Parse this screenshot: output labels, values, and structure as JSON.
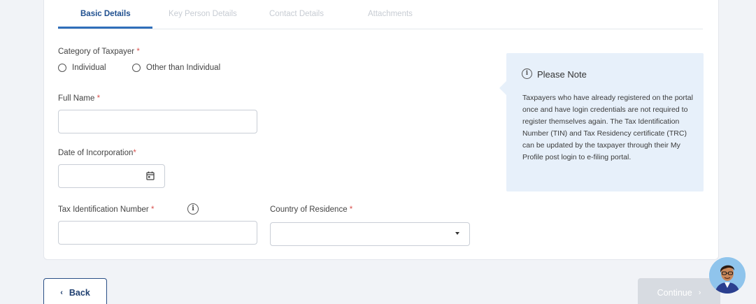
{
  "tabs": [
    {
      "label": "Basic Details",
      "active": true
    },
    {
      "label": "Key Person Details",
      "active": false
    },
    {
      "label": "Contact Details",
      "active": false
    },
    {
      "label": "Attachments",
      "active": false
    }
  ],
  "form": {
    "category_label": "Category of Taxpayer",
    "required_mark": "*",
    "category_options": [
      "Individual",
      "Other than Individual"
    ],
    "full_name_label": "Full Name",
    "full_name_value": "",
    "doi_label": "Date of Incorporation",
    "doi_value": "",
    "tin_label": "Tax Identification Number",
    "tin_value": "",
    "country_label": "Country of Residence",
    "country_value": ""
  },
  "note": {
    "title": "Please Note",
    "text": "Taxpayers who have already registered on the portal once and have login credentials are not required to register themselves again. The Tax Identification Number (TIN) and Tax Residency certificate (TRC) can be updated by the taxpayer through their My Profile post login to e-filing portal."
  },
  "buttons": {
    "back_label": "Back",
    "back_chevron": "‹",
    "continue_label": "Continue",
    "continue_chevron": "›"
  },
  "icons": {
    "info": "i",
    "calendar": "calendar-icon",
    "dropdown": "chevron-down-icon",
    "assistant": "assistant-avatar"
  },
  "colors": {
    "accent": "#2f6fba",
    "tab_active": "#1f4f8f",
    "required": "#d9534f",
    "note_bg": "#e7f0fa",
    "continue_disabled": "#d7dbe1"
  }
}
